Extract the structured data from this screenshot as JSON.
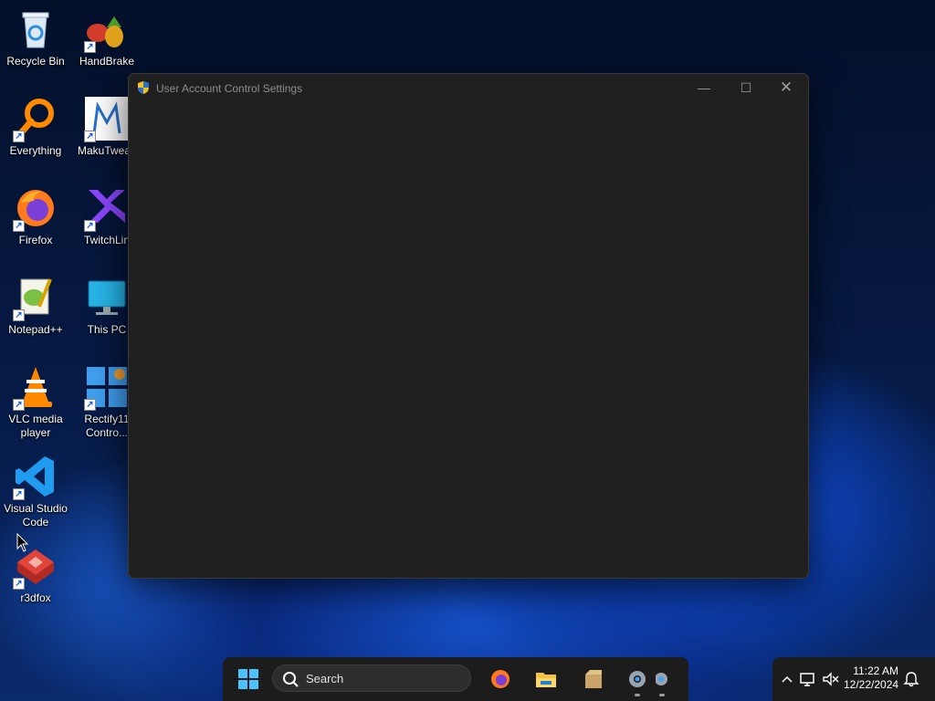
{
  "desktop": {
    "icons": [
      {
        "label": "Recycle Bin",
        "icon": "recycle-bin-icon",
        "shortcut": false
      },
      {
        "label": "HandBrake",
        "icon": "handbrake-icon",
        "shortcut": true
      },
      {
        "label": "Everything",
        "icon": "everything-search-icon",
        "shortcut": true
      },
      {
        "label": "MakuTweak",
        "icon": "makutweaker-icon",
        "shortcut": true
      },
      {
        "label": "Firefox",
        "icon": "firefox-icon",
        "shortcut": true
      },
      {
        "label": "TwitchLin",
        "icon": "twitchlink-icon",
        "shortcut": true
      },
      {
        "label": "Notepad++",
        "icon": "notepad-plus-plus-icon",
        "shortcut": true
      },
      {
        "label": "This PC",
        "icon": "this-pc-icon",
        "shortcut": false
      },
      {
        "label": "VLC media player",
        "icon": "vlc-icon",
        "shortcut": true
      },
      {
        "label": "Rectify11 Contro...",
        "icon": "rectify11-icon",
        "shortcut": true
      },
      {
        "label": "Visual Studio Code",
        "icon": "vscode-icon",
        "shortcut": true
      },
      {
        "label": "r3dfox",
        "icon": "r3dfox-icon",
        "shortcut": true
      }
    ]
  },
  "window": {
    "title": "User Account Control Settings",
    "icon": "uac-shield-icon",
    "controls": {
      "minimize": "—",
      "maximize": "☐",
      "close": "✕"
    }
  },
  "taskbar": {
    "search_label": "Search",
    "pinned": [
      "start-icon",
      "firefox-icon",
      "file-explorer-icon",
      "archive-icon",
      "settings-icon",
      "app-icon"
    ],
    "tray": {
      "time": "11:22 AM",
      "date": "12/22/2024",
      "icons": [
        "chevron-up-icon",
        "network-icon",
        "volume-muted-icon",
        "notification-bell-icon"
      ]
    }
  },
  "colors": {
    "window_bg": "#202020",
    "taskbar_bg": "#1c1c1c",
    "accent": "#0078d4"
  }
}
